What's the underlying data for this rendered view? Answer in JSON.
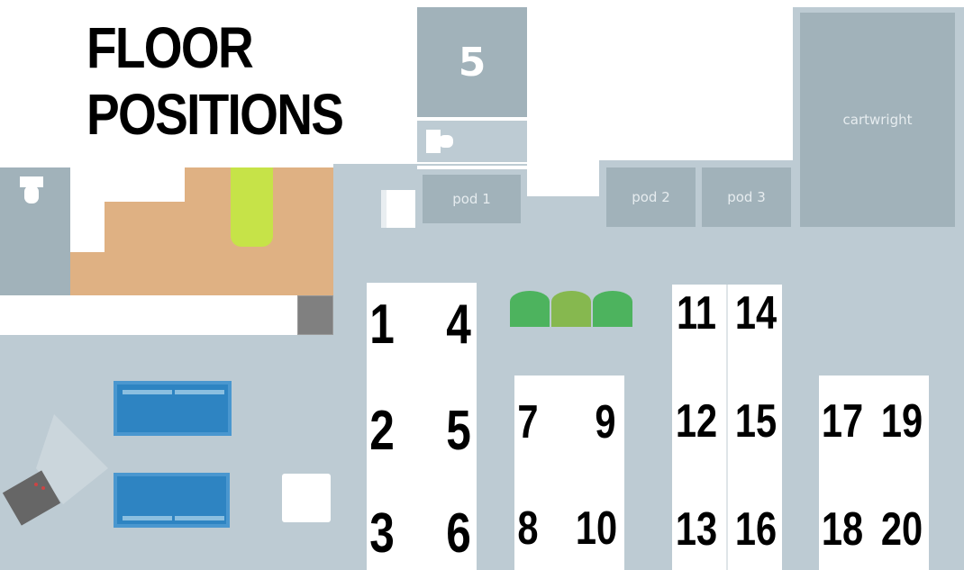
{
  "title": {
    "line1": "FLOOR",
    "line2": "POSITIONS"
  },
  "rooms": {
    "room5": "5",
    "pod1": "pod 1",
    "pod2": "pod 2",
    "pod3": "pod 3",
    "cartwright": "cartwright"
  },
  "positions": {
    "p1": "1",
    "p2": "2",
    "p3": "3",
    "p4": "4",
    "p5": "5",
    "p6": "6",
    "p7": "7",
    "p8": "8",
    "p9": "9",
    "p10": "10",
    "p11": "11",
    "p12": "12",
    "p13": "13",
    "p14": "14",
    "p15": "15",
    "p16": "16",
    "p17": "17",
    "p18": "18",
    "p19": "19",
    "p20": "20"
  },
  "colors": {
    "room": "#a1b2ba",
    "floor": "#bdcbd3",
    "kitchen": "#dfb183",
    "lime": "#c6e348",
    "couch": "#2e84c2",
    "plant": "#4db35e"
  },
  "icons": [
    "toilet-icon",
    "printer-icon",
    "projector-icon",
    "couch-icon",
    "plant-icon"
  ]
}
